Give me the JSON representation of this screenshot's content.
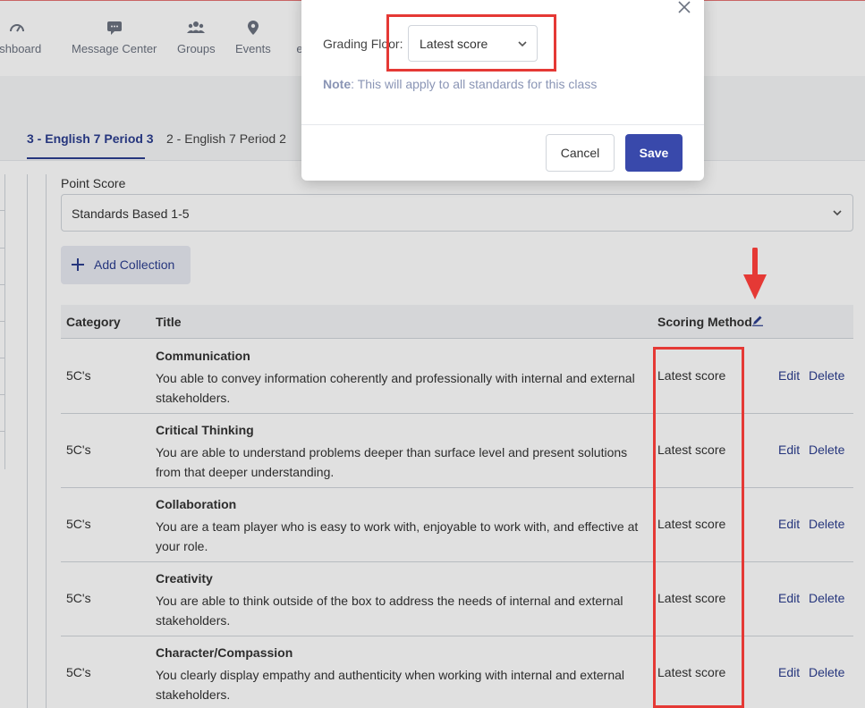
{
  "nav": {
    "items": [
      {
        "label": "ashboard",
        "icon": "dashboard-gauge-icon"
      },
      {
        "label": "Message Center",
        "icon": "chat-bubble-icon"
      },
      {
        "label": "Groups",
        "icon": "group-people-icon"
      },
      {
        "label": "Events",
        "icon": "map-pin-icon"
      },
      {
        "label": "e",
        "icon": ""
      }
    ]
  },
  "tabs": [
    {
      "label": "3 - English 7 Period 3",
      "active": true
    },
    {
      "label": "2 - English 7 Period 2",
      "active": false
    }
  ],
  "point_score": {
    "label": "Point Score",
    "value": "Standards Based 1-5"
  },
  "add_collection": {
    "label": "Add Collection"
  },
  "table": {
    "headers": {
      "category": "Category",
      "title": "Title",
      "scoring_method": "Scoring Method"
    },
    "rows": [
      {
        "category": "5C's",
        "title": "Communication",
        "description": "You able to convey information coherently and professionally with internal and external stakeholders.",
        "method": "Latest score",
        "edit": "Edit",
        "delete": "Delete"
      },
      {
        "category": "5C's",
        "title": "Critical Thinking",
        "description": "You are able to understand problems deeper than surface level and present solutions from that deeper understanding.",
        "method": "Latest score",
        "edit": "Edit",
        "delete": "Delete"
      },
      {
        "category": "5C's",
        "title": "Collaboration",
        "description": "You are a team player who is easy to work with, enjoyable to work with, and effective at your role.",
        "method": "Latest score",
        "edit": "Edit",
        "delete": "Delete"
      },
      {
        "category": "5C's",
        "title": "Creativity",
        "description": "You are able to think outside of the box to address the needs of internal and external stakeholders.",
        "method": "Latest score",
        "edit": "Edit",
        "delete": "Delete"
      },
      {
        "category": "5C's",
        "title": "Character/Compassion",
        "description": "You clearly display empathy and authenticity when working with internal and external stakeholders.",
        "method": "Latest score",
        "edit": "Edit",
        "delete": "Delete"
      }
    ]
  },
  "modal": {
    "grading_floor_label": "Grading Floor:",
    "grading_floor_value": "Latest score",
    "note_prefix": "Note",
    "note_text": ": This will apply to all standards for this class",
    "cancel_label": "Cancel",
    "save_label": "Save"
  },
  "colors": {
    "accent": "#2c3e8f",
    "primary_button": "#3949ab",
    "annotation": "#e53935"
  }
}
